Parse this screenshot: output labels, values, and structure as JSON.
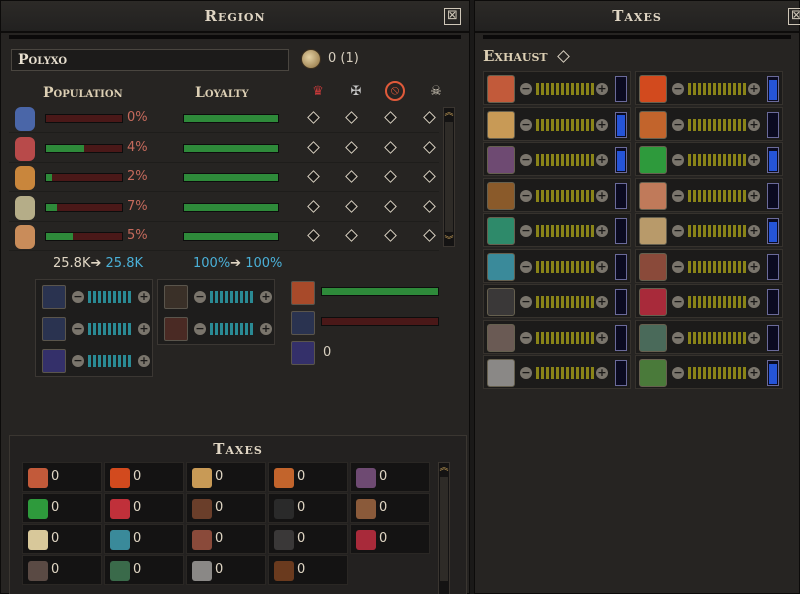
{
  "region_panel": {
    "title": "Region",
    "close": "⊠",
    "region_name": "Polyxo",
    "coin_text": "0 (1)",
    "population_label": "Population",
    "loyalty_label": "Loyalty",
    "header_icons": [
      "faction-crown-icon",
      "rebel-icon",
      "forbidden-icon",
      "skull-icon"
    ],
    "rows": [
      {
        "race": "elf-icon",
        "pct": "0%",
        "pop_fill": 0.0,
        "loyalty_fill": 1.0,
        "color": "#4a66a8"
      },
      {
        "race": "dwarf-icon",
        "pct": "4%",
        "pop_fill": 0.5,
        "loyalty_fill": 1.0,
        "color": "#b84a4a"
      },
      {
        "race": "orc-icon",
        "pct": "2%",
        "pop_fill": 0.08,
        "loyalty_fill": 1.0,
        "color": "#c9863c"
      },
      {
        "race": "undead-icon",
        "pct": "7%",
        "pop_fill": 0.14,
        "loyalty_fill": 1.0,
        "color": "#b5ad88"
      },
      {
        "race": "human-icon",
        "pct": "5%",
        "pop_fill": 0.35,
        "loyalty_fill": 1.0,
        "color": "#c98c5a"
      }
    ],
    "pop_from": "25.8K",
    "pop_arrow": "➔",
    "pop_to": "25.8K",
    "loyal_from": "100%",
    "loyal_to": "100%",
    "resource_value": "0"
  },
  "bottom_taxes": {
    "title": "Taxes",
    "cells": [
      {
        "icon": "ore-icon",
        "value": "0",
        "color": "#c25a3a"
      },
      {
        "icon": "fruit-icon",
        "value": "0",
        "color": "#d24a1e"
      },
      {
        "icon": "bread-icon",
        "value": "0",
        "color": "#c89a56"
      },
      {
        "icon": "mushroom-icon",
        "value": "0",
        "color": "#c2642c"
      },
      {
        "icon": "grain-sack-icon",
        "value": "0",
        "color": "#6e4a72"
      },
      {
        "icon": "cucumber-icon",
        "value": "0",
        "color": "#2e9a3c"
      },
      {
        "icon": "meat-icon",
        "value": "0",
        "color": "#c0303a"
      },
      {
        "icon": "leather-icon",
        "value": "0",
        "color": "#6a3e2a"
      },
      {
        "icon": "coal-icon",
        "value": "0",
        "color": "#2a2a2a"
      },
      {
        "icon": "crate-icon",
        "value": "0",
        "color": "#8a5a3a"
      },
      {
        "icon": "egg-icon",
        "value": "0",
        "color": "#d8c89a"
      },
      {
        "icon": "fish-icon",
        "value": "0",
        "color": "#3a8a9a"
      },
      {
        "icon": "clay-icon",
        "value": "0",
        "color": "#8a4a3a"
      },
      {
        "icon": "stone-pile-icon",
        "value": "0",
        "color": "#3a3838"
      },
      {
        "icon": "gem-icon",
        "value": "0",
        "color": "#a82a3a"
      },
      {
        "icon": "iron-ore-icon",
        "value": "0",
        "color": "#5a4a44"
      },
      {
        "icon": "herbs-icon",
        "value": "0",
        "color": "#3a6a4a"
      },
      {
        "icon": "stone-block-icon",
        "value": "0",
        "color": "#8a8886"
      },
      {
        "icon": "wood-icon",
        "value": "0",
        "color": "#6a3a1e"
      }
    ]
  },
  "taxes_panel": {
    "title": "Taxes",
    "exhaust_label": "Exhaust",
    "rows": [
      {
        "icon": "ore-icon",
        "gauge": 0.0,
        "color": "#c25a3a"
      },
      {
        "icon": "fruit-icon",
        "gauge": 0.85,
        "color": "#d24a1e"
      },
      {
        "icon": "bread-icon",
        "gauge": 0.85,
        "color": "#c89a56"
      },
      {
        "icon": "mushroom-icon",
        "gauge": 0.0,
        "color": "#c2642c"
      },
      {
        "icon": "grain-sack-icon",
        "gauge": 0.85,
        "color": "#6e4a72"
      },
      {
        "icon": "cucumber-icon",
        "gauge": 0.85,
        "color": "#2e9a3c"
      },
      {
        "icon": "leather-icon",
        "gauge": 0.0,
        "color": "#8a5a2a"
      },
      {
        "icon": "meat-icon",
        "gauge": 0.0,
        "color": "#c07a5a"
      },
      {
        "icon": "reptile-icon",
        "gauge": 0.0,
        "color": "#2e8a6a"
      },
      {
        "icon": "horn-icon",
        "gauge": 0.85,
        "color": "#b89a6a"
      },
      {
        "icon": "fish-icon",
        "gauge": 0.0,
        "color": "#3a8a9a"
      },
      {
        "icon": "clay-icon",
        "gauge": 0.0,
        "color": "#8a4a3a"
      },
      {
        "icon": "coal-icon",
        "gauge": 0.0,
        "color": "#3a3838"
      },
      {
        "icon": "gem-icon",
        "gauge": 0.0,
        "color": "#a82a3a"
      },
      {
        "icon": "iron-ore-icon",
        "gauge": 0.0,
        "color": "#6a5a54"
      },
      {
        "icon": "herbs-icon",
        "gauge": 0.0,
        "color": "#4a6a5a"
      },
      {
        "icon": "stone-block-icon",
        "gauge": 0.0,
        "color": "#8a8886"
      },
      {
        "icon": "wood-icon",
        "gauge": 0.85,
        "color": "#4a7a3a"
      }
    ]
  }
}
